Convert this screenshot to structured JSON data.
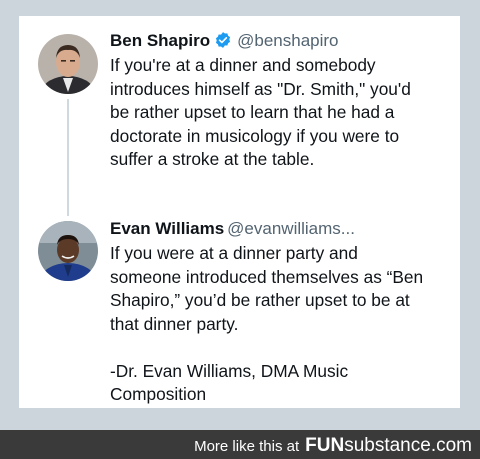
{
  "tweet1": {
    "name": "Ben Shapiro",
    "handle": "@benshapiro",
    "lines": [
      "If you're at a dinner and somebody",
      "introduces himself as \"Dr. Smith,\" you'd",
      "be rather upset to learn that he had a",
      "doctorate in musicology if you were to",
      "suffer a stroke at the table."
    ]
  },
  "tweet2": {
    "name": "Evan Williams",
    "handle": "@evanwilliams...",
    "lines": [
      "If you were at a dinner party and",
      "someone introduced themselves as “Ben",
      "Shapiro,” you’d be rather upset to be at",
      "that dinner party."
    ],
    "signature": [
      "-Dr. Evan Williams, DMA Music",
      "Composition"
    ]
  },
  "footer": {
    "prefix": "More like this at",
    "brand_a": "FUN",
    "brand_b": "substance.com"
  },
  "colors": {
    "verified_badge": "#1d9bf0",
    "handle": "#536471",
    "frame": "#ccd4dc",
    "footer": "#3a3a3a"
  }
}
